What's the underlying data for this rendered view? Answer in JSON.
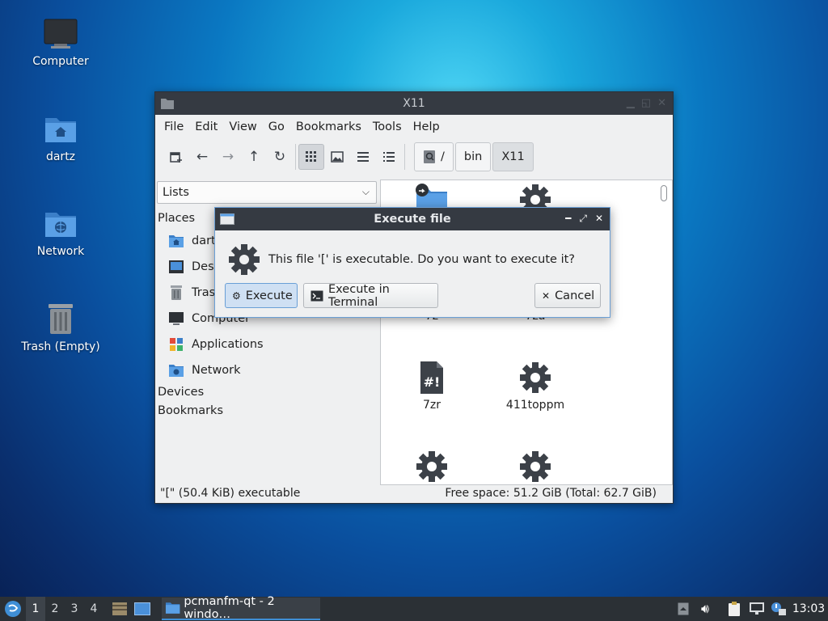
{
  "desktop": {
    "icons": [
      {
        "label": "Computer"
      },
      {
        "label": "dartz"
      },
      {
        "label": "Network"
      },
      {
        "label": "Trash (Empty)"
      }
    ]
  },
  "window": {
    "title": "X11",
    "menu": [
      "File",
      "Edit",
      "View",
      "Go",
      "Bookmarks",
      "Tools",
      "Help"
    ],
    "breadcrumb": [
      "/",
      "bin",
      "X11"
    ],
    "side_mode": "Lists",
    "places_header": "Places",
    "places": [
      {
        "label": "dartz"
      },
      {
        "label": "Desktop"
      },
      {
        "label": "Trash"
      },
      {
        "label": "Computer"
      },
      {
        "label": "Applications"
      },
      {
        "label": "Network"
      }
    ],
    "devices_header": "Devices",
    "bookmarks_header": "Bookmarks",
    "files": [
      {
        "label": "7z"
      },
      {
        "label": "7za"
      },
      {
        "label": "7zr"
      },
      {
        "label": "411toppm"
      }
    ],
    "status_left": "\"[\" (50.4 KiB) executable",
    "status_right": "Free space: 51.2 GiB (Total: 62.7 GiB)"
  },
  "dialog": {
    "title": "Execute file",
    "message": "This file '[' is executable. Do you want to execute it?",
    "execute_label": "Execute",
    "terminal_label": "Execute in Terminal",
    "cancel_label": "Cancel"
  },
  "taskbar": {
    "workspaces": [
      "1",
      "2",
      "3",
      "4"
    ],
    "task_label": "pcmanfm-qt - 2 windo…",
    "clock": "13:03"
  },
  "colors": {
    "accent": "#3f8fd6",
    "folder_blue": "#4a90d9",
    "titlebar": "#353a42"
  }
}
